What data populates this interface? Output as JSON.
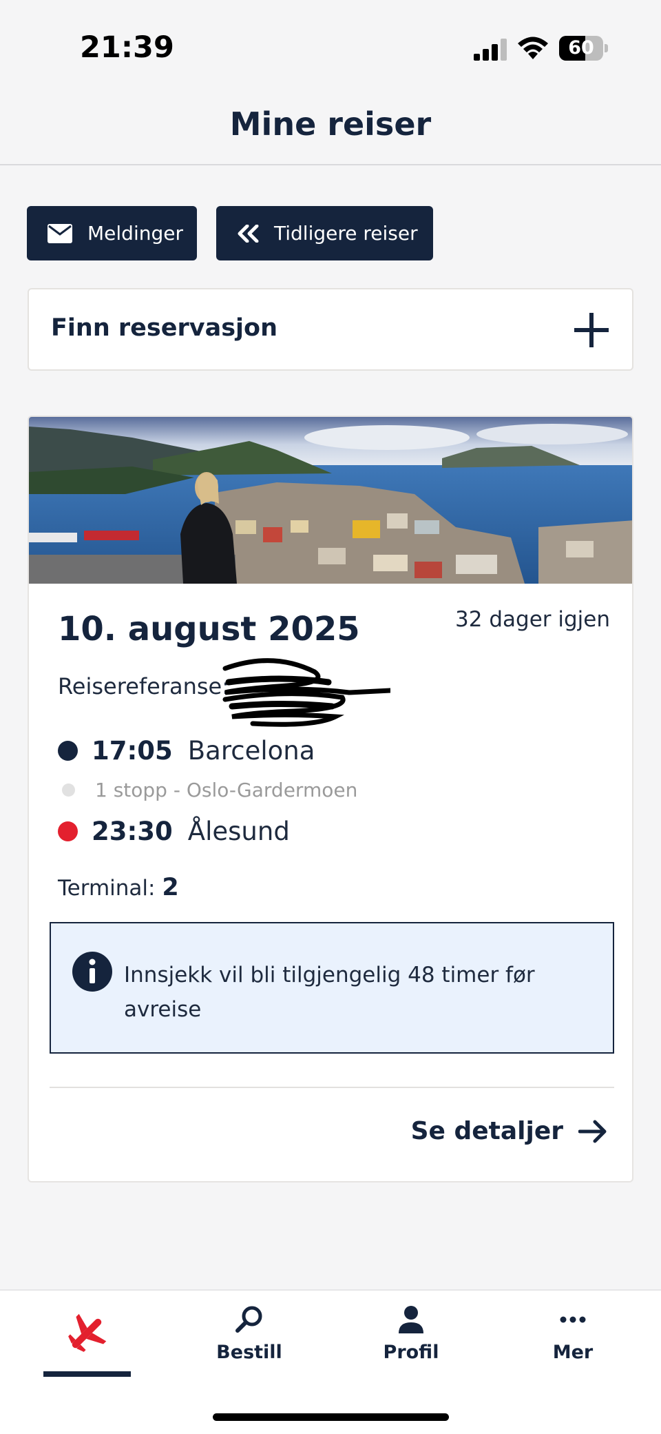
{
  "status_bar": {
    "time": "21:39",
    "battery": "60",
    "battery_level": 0.6
  },
  "header": {
    "title": "Mine reiser"
  },
  "actions": {
    "messages_label": "Meldinger",
    "previous_trips_label": "Tidligere reiser"
  },
  "find_reservation": {
    "label": "Finn reservasjon"
  },
  "trip": {
    "date": "10. august 2025",
    "days_left": "32 dager igjen",
    "reference_label": "Reisereferanse:",
    "departure": {
      "time": "17:05",
      "place": "Barcelona",
      "dot_color": "#15243d"
    },
    "stop": {
      "text": "1 stopp - Oslo-Gardermoen"
    },
    "arrival": {
      "time": "23:30",
      "place": "Ålesund",
      "dot_color": "#e3202e"
    },
    "terminal_label": "Terminal:",
    "terminal_value": "2",
    "info_text": "Innsjekk vil bli tilgjengelig 48 timer før avreise",
    "details_label": "Se detaljer"
  },
  "bottom_nav": {
    "items": [
      {
        "label": "",
        "icon": "airplane-icon",
        "active": true
      },
      {
        "label": "Bestill",
        "icon": "search-icon"
      },
      {
        "label": "Profil",
        "icon": "person-icon"
      },
      {
        "label": "Mer",
        "icon": "more-icon"
      }
    ]
  },
  "colors": {
    "navy": "#15243d",
    "red": "#e3202e",
    "info_bg": "#eaf2fd"
  }
}
